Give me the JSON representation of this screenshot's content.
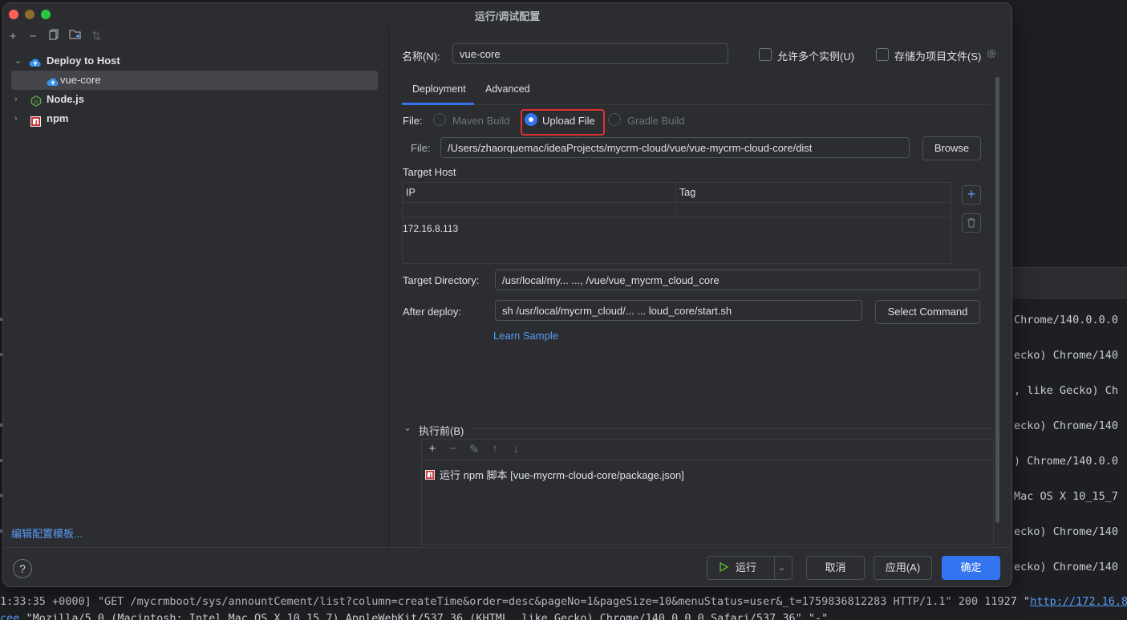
{
  "dialog": {
    "title": "运行/调试配置",
    "edit_templates_link": "编辑配置模板..."
  },
  "toolbar": {
    "add_icon": "plus-icon",
    "remove_icon": "minus-icon",
    "copy_icon": "copy-icon",
    "folder_icon": "new-folder-icon",
    "sort_icon": "sort-icon"
  },
  "tree": {
    "items": [
      {
        "label": "Deploy to Host",
        "icon": "cloud-upload-icon",
        "expanded": true
      },
      {
        "label": "vue-core",
        "icon": "cloud-upload-icon",
        "selected": true
      },
      {
        "label": "Node.js",
        "icon": "nodejs-icon",
        "expanded": false
      },
      {
        "label": "npm",
        "icon": "npm-icon",
        "expanded": false
      }
    ]
  },
  "config": {
    "name_label": "名称(N):",
    "name_value": "vue-core",
    "allow_multiple_label": "允许多个实例(U)",
    "store_as_file_label": "存储为项目文件(S)",
    "tabs": [
      "Deployment",
      "Advanced"
    ],
    "active_tab": "Deployment",
    "file_label": "File:",
    "file_options": [
      "Maven Build",
      "Upload File",
      "Gradle Build"
    ],
    "file_selected": "Upload File",
    "file_path_label": "File:",
    "file_path_value": "/Users/zhaorquemac/ideaProjects/mycrm-cloud/vue/vue-mycrm-cloud-core/dist",
    "browse_label": "Browse",
    "target_host_label": "Target Host",
    "host_table": {
      "columns": [
        "IP",
        "Tag"
      ],
      "rows": [
        [
          "172.16.8.113",
          ""
        ]
      ]
    },
    "target_directory_label": "Target Directory:",
    "target_directory_value": "/usr/local/my... ..., /vue/vue_mycrm_cloud_core",
    "after_deploy_label": "After deploy:",
    "after_deploy_value": "sh /usr/local/mycrm_cloud/... ... loud_core/start.sh",
    "select_command_label": "Select Command",
    "learn_sample_label": "Learn Sample",
    "before_launch_label": "执行前(B)",
    "before_launch_task": "运行 npm 脚本 [vue-mycrm-cloud-core/package.json]"
  },
  "footer": {
    "help_label": "?",
    "run_label": "运行",
    "cancel_label": "取消",
    "apply_label": "应用(A)",
    "ok_label": "确定"
  },
  "background": {
    "log_right": [
      "Chrome/140.0.0.0",
      "ecko) Chrome/140",
      ", like Gecko) Ch",
      "ecko) Chrome/140",
      ") Chrome/140.0.0",
      "Mac OS X 10_15_7",
      "ecko) Chrome/140",
      "ecko) Chrome/140"
    ],
    "bottom_line_1": "1:33:35 +0000] \"GET /mycrmboot/sys/annountCement/list?column=createTime&order=desc&pageNo=1&pageSize=10&menuStatus=user&_t=1759836812283 HTTP/1.1\" 200 11927 \"",
    "bottom_line_1_link": "http://172.16.8.",
    "bottom_line_2_link": "cee",
    "bottom_line_2": "\"Mozilla/5.0 (Macintosh; Intel Mac OS X 10_15_7) AppleWebKit/537.36 (KHTML, like Gecko) Chrome/140.0.0.0 Safari/537.36\" \"-\""
  },
  "colors": {
    "accent": "#3574f0",
    "highlight": "#e03131",
    "link": "#589df6"
  }
}
